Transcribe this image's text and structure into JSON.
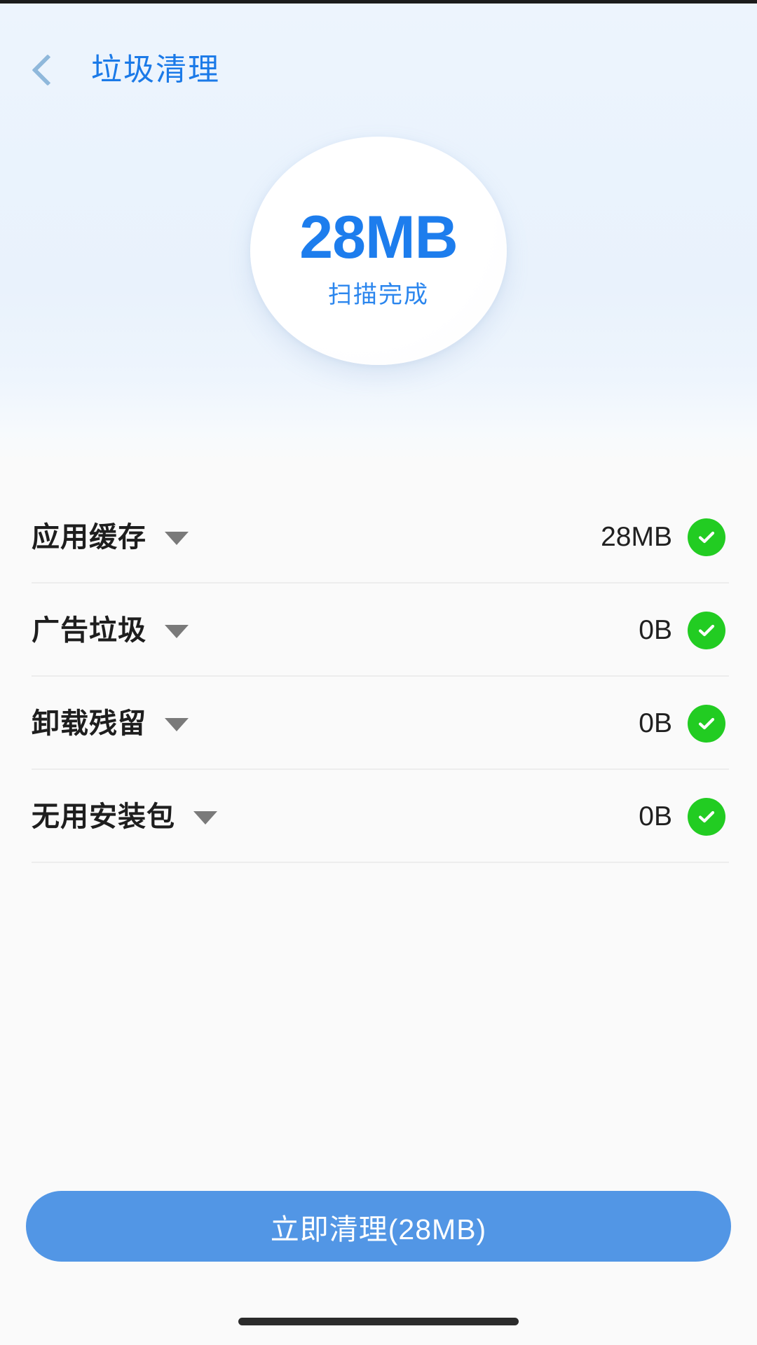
{
  "app": {
    "title": "垃圾清理",
    "back_icon": "chevron-left-icon",
    "accent_blue": "#1b7ae8",
    "button_blue": "#5296e5",
    "check_green": "#22cc22"
  },
  "scan": {
    "size": "28MB",
    "status": "扫描完成"
  },
  "list": [
    {
      "label": "应用缓存",
      "value": "28MB",
      "caret": "caret-down-icon",
      "checked": true
    },
    {
      "label": "广告垃圾",
      "value": "0B",
      "caret": "caret-down-icon",
      "checked": true
    },
    {
      "label": "卸载残留",
      "value": "0B",
      "caret": "caret-down-icon",
      "checked": true
    },
    {
      "label": "无用安装包",
      "value": "0B",
      "caret": "caret-down-icon",
      "checked": true
    }
  ],
  "cta": {
    "label": "立即清理(28MB)"
  }
}
